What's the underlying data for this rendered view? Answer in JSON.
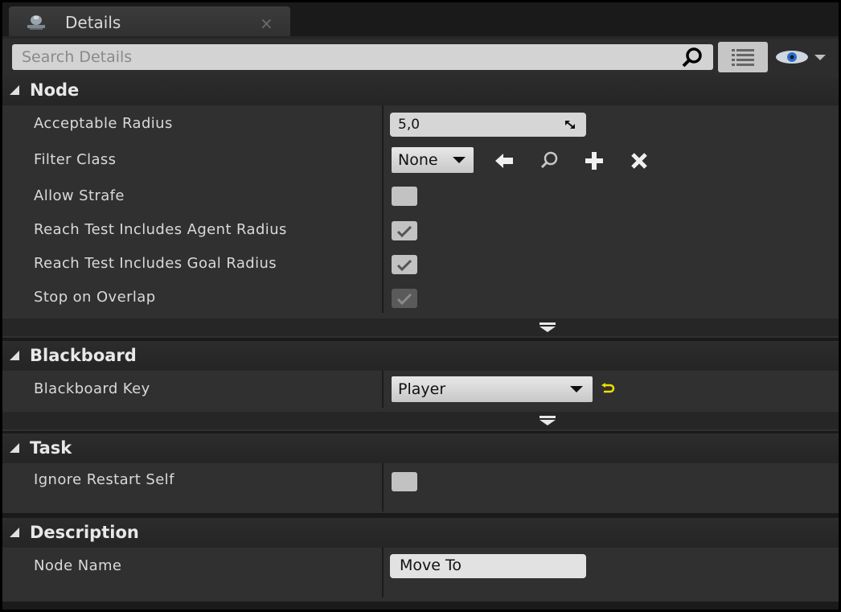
{
  "tab": {
    "title": "Details",
    "close": "×",
    "icon": "details-panel-icon"
  },
  "search": {
    "placeholder": "Search Details",
    "value": ""
  },
  "categories": {
    "node": {
      "title": "Node",
      "acceptable_radius": {
        "label": "Acceptable Radius",
        "value": "5,0"
      },
      "filter_class": {
        "label": "Filter Class",
        "value": "None"
      },
      "allow_strafe": {
        "label": "Allow Strafe",
        "checked": false
      },
      "reach_agent": {
        "label": "Reach Test Includes Agent Radius",
        "checked": true
      },
      "reach_goal": {
        "label": "Reach Test Includes Goal Radius",
        "checked": true
      },
      "stop_overlap": {
        "label": "Stop on Overlap",
        "checked": true,
        "disabled": true
      }
    },
    "blackboard": {
      "title": "Blackboard",
      "key": {
        "label": "Blackboard Key",
        "value": "Player"
      }
    },
    "task": {
      "title": "Task",
      "ignore_restart": {
        "label": "Ignore Restart Self",
        "checked": false
      }
    },
    "description": {
      "title": "Description",
      "node_name": {
        "label": "Node Name",
        "value": "Move To"
      }
    }
  },
  "colors": {
    "panel": "#303030",
    "header": "#262626",
    "accent_reset": "#f0e000"
  }
}
